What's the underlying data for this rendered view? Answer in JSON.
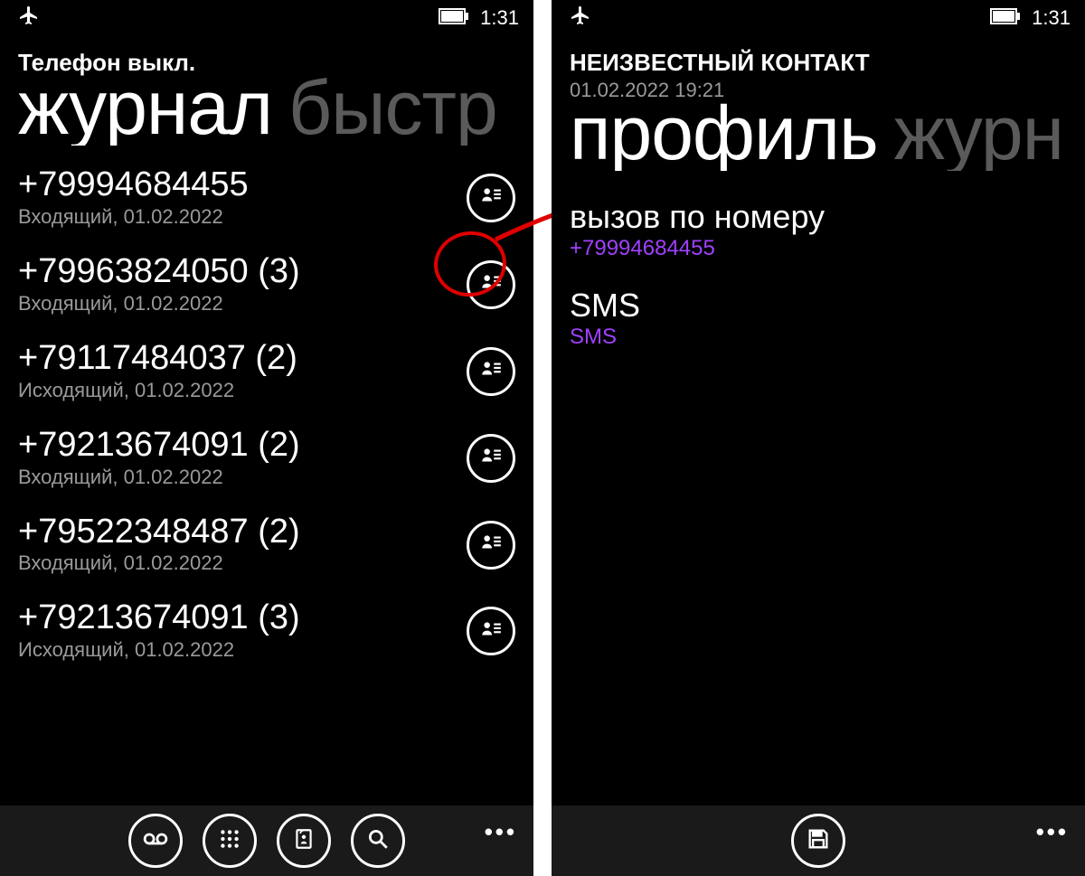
{
  "status": {
    "time": "1:31"
  },
  "left": {
    "header": "Телефон выкл.",
    "pivot_active": "журнал",
    "pivot_inactive": "быстр",
    "entries": [
      {
        "number": "+79994684455",
        "sub": "Входящий, 01.02.2022"
      },
      {
        "number": "+79963824050 (3)",
        "sub": "Входящий, 01.02.2022"
      },
      {
        "number": "+79117484037 (2)",
        "sub": "Исходящий, 01.02.2022"
      },
      {
        "number": "+79213674091 (2)",
        "sub": "Входящий, 01.02.2022"
      },
      {
        "number": "+79522348487 (2)",
        "sub": "Входящий, 01.02.2022"
      },
      {
        "number": "+79213674091 (3)",
        "sub": "Исходящий, 01.02.2022"
      }
    ]
  },
  "right": {
    "header": "НЕИЗВЕСТНЫЙ КОНТАКТ",
    "timestamp": "01.02.2022 19:21",
    "pivot_active": "профиль",
    "pivot_inactive": "журн",
    "call_label": "вызов по номеру",
    "call_value": "+79994684455",
    "sms_label": "SMS",
    "sms_value": "SMS"
  }
}
